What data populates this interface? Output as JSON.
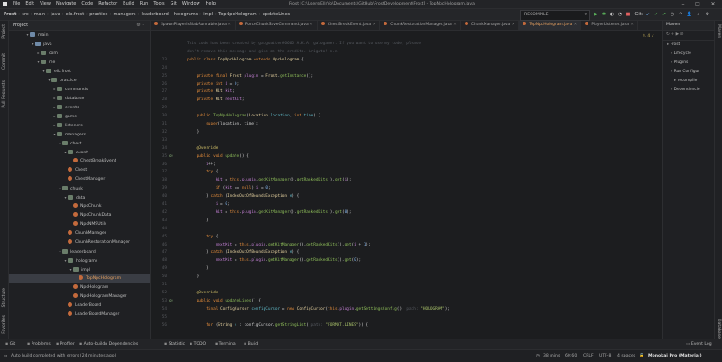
{
  "menu": [
    "File",
    "Edit",
    "View",
    "Navigate",
    "Code",
    "Refactor",
    "Build",
    "Run",
    "Tools",
    "Git",
    "Window",
    "Help"
  ],
  "window_title": "Frost [C:\\Users\\EllrVo\\Documents\\GitHub\\FrostDevelopment\\Frost] - TopNpcHologram.java",
  "breadcrumbs": [
    "Frost",
    "src",
    "main",
    "java",
    "elb.frost",
    "practice",
    "managers",
    "leaderboard",
    "holograms",
    "impl",
    "TopNpcHologram",
    "updateLines"
  ],
  "run_config": "RECOMPILE",
  "git_label": "Git:",
  "project_panel_title": "Project",
  "tree": [
    {
      "label": "main",
      "indent": 3,
      "icon": "folder",
      "open": true
    },
    {
      "label": "java",
      "indent": 4,
      "icon": "folder",
      "open": true
    },
    {
      "label": "com",
      "indent": 5,
      "icon": "pkg",
      "open": false
    },
    {
      "label": "me",
      "indent": 5,
      "icon": "pkg",
      "open": true
    },
    {
      "label": "elb.frost",
      "indent": 6,
      "icon": "pkg",
      "open": true
    },
    {
      "label": "practice",
      "indent": 7,
      "icon": "pkg",
      "open": true
    },
    {
      "label": "commands",
      "indent": 8,
      "icon": "pkg",
      "open": false
    },
    {
      "label": "database",
      "indent": 8,
      "icon": "pkg",
      "open": false
    },
    {
      "label": "events",
      "indent": 8,
      "icon": "pkg",
      "open": false
    },
    {
      "label": "game",
      "indent": 8,
      "icon": "pkg",
      "open": false
    },
    {
      "label": "listeners",
      "indent": 8,
      "icon": "pkg",
      "open": false
    },
    {
      "label": "managers",
      "indent": 8,
      "icon": "pkg",
      "open": true
    },
    {
      "label": "chest",
      "indent": 9,
      "icon": "pkg",
      "open": true
    },
    {
      "label": "event",
      "indent": 10,
      "icon": "pkg",
      "open": true
    },
    {
      "label": "ChestBreakEvent",
      "indent": 11,
      "icon": "file",
      "open": null
    },
    {
      "label": "Chest",
      "indent": 10,
      "icon": "file",
      "open": null
    },
    {
      "label": "ChestManager",
      "indent": 10,
      "icon": "file",
      "open": null
    },
    {
      "label": "chunk",
      "indent": 9,
      "icon": "pkg",
      "open": true
    },
    {
      "label": "data",
      "indent": 10,
      "icon": "pkg",
      "open": true
    },
    {
      "label": "NpcChunk",
      "indent": 11,
      "icon": "file",
      "open": null
    },
    {
      "label": "NpcChunkData",
      "indent": 11,
      "icon": "file",
      "open": null
    },
    {
      "label": "NpcNMSUtils",
      "indent": 11,
      "icon": "file",
      "open": null
    },
    {
      "label": "ChunkManager",
      "indent": 10,
      "icon": "file",
      "open": null
    },
    {
      "label": "ChunkRestorationManager",
      "indent": 10,
      "icon": "file",
      "open": null
    },
    {
      "label": "leaderboard",
      "indent": 9,
      "icon": "pkg",
      "open": true
    },
    {
      "label": "holograms",
      "indent": 10,
      "icon": "pkg",
      "open": true
    },
    {
      "label": "impl",
      "indent": 11,
      "icon": "pkg",
      "open": true
    },
    {
      "label": "TopNpcHologram",
      "indent": 12,
      "icon": "file",
      "open": null,
      "selected": true
    },
    {
      "label": "NpcHologram",
      "indent": 11,
      "icon": "file",
      "open": null
    },
    {
      "label": "NpcHologramManager",
      "indent": 11,
      "icon": "file",
      "open": null
    },
    {
      "label": "LeaderBoard",
      "indent": 10,
      "icon": "file",
      "open": null
    },
    {
      "label": "LeaderBoardManager",
      "indent": 10,
      "icon": "file",
      "open": null
    }
  ],
  "tabs": [
    {
      "label": "SpawnPlayerIsBlabRunnable.java",
      "active": false
    },
    {
      "label": "ForceChunkSaveCommand.java",
      "active": false
    },
    {
      "label": "ChestBreakEvent.java",
      "active": false
    },
    {
      "label": "ChunkRestorationManager.java",
      "active": false
    },
    {
      "label": "ChunkManager.java",
      "active": false
    },
    {
      "label": "TopNpcHologram.java",
      "active": true
    },
    {
      "label": "PlayerListener.java",
      "active": false
    }
  ],
  "code_lines": [
    {
      "n": "",
      "g": "",
      "html": "<span class='c'>This code has been created by galgoatten#6666 A.K.A. galogamer. If you want to use my code, please</span>"
    },
    {
      "n": "",
      "g": "",
      "html": "<span class='c'>don't remove this message and give me the credits. Arigato! n.n</span>"
    },
    {
      "n": "23",
      "g": "",
      "html": "<span class='k'>public class</span> <span class='t'>TopNpcHologram</span> <span class='k'>extends</span> <span class='t'>NpcHologram</span> {"
    },
    {
      "n": "24",
      "g": "",
      "html": ""
    },
    {
      "n": "25",
      "g": "",
      "html": "    <span class='k'>private final</span> <span class='t'>Frost</span> <span class='f'>plugin</span> = <span class='t'>Frost</span>.<span class='m2'>getInstance</span>();"
    },
    {
      "n": "26",
      "g": "",
      "html": "    <span class='k'>private int</span> <span class='f'>i</span> = <span class='n'>0</span>;"
    },
    {
      "n": "27",
      "g": "",
      "html": "    <span class='k'>private</span> <span class='t'>Kit</span> <span class='f'>kit</span>;"
    },
    {
      "n": "28",
      "g": "",
      "html": "    <span class='k'>private</span> <span class='t'>Kit</span> <span class='f'>nextKit</span>;"
    },
    {
      "n": "29",
      "g": "",
      "html": ""
    },
    {
      "n": "30",
      "g": "",
      "html": "    <span class='k'>public</span> <span class='m2'>TopNpcHologram</span>(<span class='t'>Location</span> <span class='p'>location</span>, <span class='k'>int</span> <span class='p'>time</span>) {"
    },
    {
      "n": "31",
      "g": "",
      "html": "        <span class='k'>super</span>(location, time);"
    },
    {
      "n": "32",
      "g": "",
      "html": "    }"
    },
    {
      "n": "33",
      "g": "",
      "html": ""
    },
    {
      "n": "34",
      "g": "",
      "html": "    <span class='a'>@Override</span>"
    },
    {
      "n": "35",
      "g": "o↑",
      "html": "    <span class='k'>public void</span> <span class='m2'>update</span>() {"
    },
    {
      "n": "36",
      "g": "",
      "html": "        <span class='f'>i</span>++;"
    },
    {
      "n": "37",
      "g": "",
      "html": "        <span class='k'>try</span> {"
    },
    {
      "n": "38",
      "g": "",
      "html": "            <span class='f'>kit</span> = <span class='k'>this</span>.<span class='f'>plugin</span>.<span class='m2'>getKitManager</span>().<span class='m2'>getRankedKits</span>().<span class='m2'>get</span>(<span class='f'>i</span>);"
    },
    {
      "n": "39",
      "g": "",
      "html": "            <span class='k'>if</span> (<span class='f'>kit</span> == <span class='k'>null</span>) <span class='f'>i</span> = <span class='n'>0</span>;"
    },
    {
      "n": "40",
      "g": "",
      "html": "        } <span class='k'>catch</span> (<span class='t'>IndexOutOfBoundsException</span> <span class='p'>e</span>) {"
    },
    {
      "n": "41",
      "g": "",
      "html": "            <span class='f'>i</span> = <span class='n'>0</span>;"
    },
    {
      "n": "42",
      "g": "",
      "html": "            <span class='f'>kit</span> = <span class='k'>this</span>.<span class='f'>plugin</span>.<span class='m2'>getKitManager</span>().<span class='m2'>getRankedKits</span>().<span class='m2'>get</span>(<span class='n'>0</span>);"
    },
    {
      "n": "43",
      "g": "",
      "html": "        }"
    },
    {
      "n": "44",
      "g": "",
      "html": ""
    },
    {
      "n": "45",
      "g": "",
      "html": "        <span class='k'>try</span> {"
    },
    {
      "n": "46",
      "g": "",
      "html": "            <span class='f'>nextKit</span> = <span class='k'>this</span>.<span class='f'>plugin</span>.<span class='m2'>getKitManager</span>().<span class='m2'>getRankedKits</span>().<span class='m2'>get</span>(<span class='f'>i</span> + <span class='n'>1</span>);"
    },
    {
      "n": "47",
      "g": "",
      "html": "        } <span class='k'>catch</span> (<span class='t'>IndexOutOfBoundsException</span> <span class='p'>e</span>) {"
    },
    {
      "n": "48",
      "g": "",
      "html": "            <span class='f'>nextKit</span> = <span class='k'>this</span>.<span class='f'>plugin</span>.<span class='m2'>getKitManager</span>().<span class='m2'>getRankedKits</span>().<span class='m2'>get</span>(<span class='n'>0</span>);"
    },
    {
      "n": "49",
      "g": "",
      "html": "        }"
    },
    {
      "n": "50",
      "g": "",
      "html": "    }"
    },
    {
      "n": "51",
      "g": "",
      "html": ""
    },
    {
      "n": "52",
      "g": "",
      "html": "    <span class='a'>@Override</span>"
    },
    {
      "n": "53",
      "g": "o↑",
      "html": "    <span class='k'>public void</span> <span class='m2'>updateLines</span>() {"
    },
    {
      "n": "54",
      "g": "",
      "html": "        <span class='k'>final</span> <span class='t'>ConfigCursor</span> <span class='p'>configCursor</span> = <span class='k'>new</span> <span class='t'>ConfigCursor</span>(<span class='k'>this</span>.<span class='f'>plugin</span>.<span class='m2'>getSettingsConfig</span>(), <span class='c'>path:</span> <span class='s'>\"HOLOGRAM\"</span>);"
    },
    {
      "n": "55",
      "g": "",
      "html": ""
    },
    {
      "n": "56",
      "g": "",
      "html": "        <span class='k'>for</span> (<span class='t'>String</span> <span class='p'>s</span> : configCursor.<span class='m2'>getStringList</span>( <span class='c'>path:</span> <span class='s'>\"FORMAT.LINES\"</span>)) {"
    }
  ],
  "right_panel": {
    "title": "Maven",
    "items": [
      {
        "label": "Frost",
        "indent": 1
      },
      {
        "label": "Lifecycle",
        "indent": 2
      },
      {
        "label": "Plugins",
        "indent": 2
      },
      {
        "label": "Run Configur",
        "indent": 2
      },
      {
        "label": "recompile",
        "indent": 3
      },
      {
        "label": "Dependencie",
        "indent": 2
      }
    ]
  },
  "left_stripe": [
    "Project",
    "Commit",
    "Pull Requests",
    "Structure",
    "Favorites"
  ],
  "right_stripe": [
    "Maven",
    "Database"
  ],
  "tool_windows": [
    "Git",
    "Problems",
    "Profiler",
    "Auto-build",
    "Dependencies",
    "Statistic",
    "TODO",
    "Terminal",
    "Build"
  ],
  "event_log": "Event Log",
  "status": {
    "message": "Auto build completed with errors (24 minutes ago)",
    "time": "38 mins",
    "position": "60:60",
    "line_sep": "CRLF",
    "encoding": "UTF-8",
    "indent": "4 spaces",
    "theme": "Monokai Pro (Material)"
  }
}
